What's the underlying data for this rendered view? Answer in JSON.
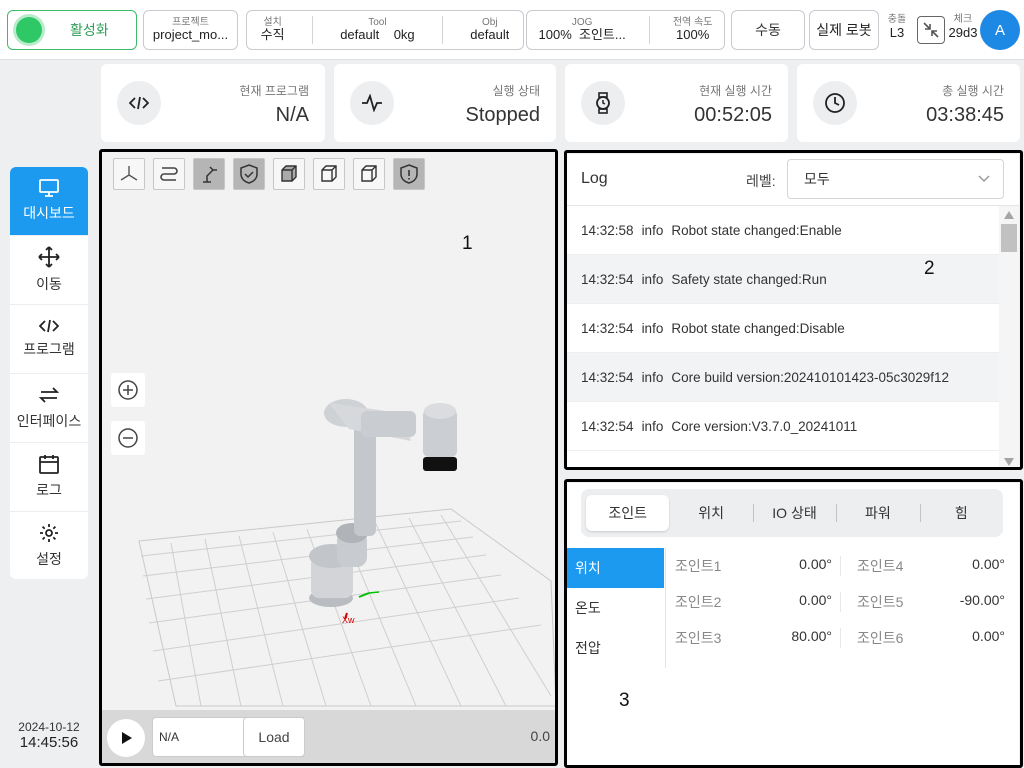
{
  "topbar": {
    "activate_label": "활성화",
    "project": {
      "label": "프로젝트",
      "value": "project_mo..."
    },
    "install": {
      "label": "설치",
      "value": "수직"
    },
    "tool": {
      "label": "Tool",
      "value": "default",
      "load": "0kg"
    },
    "obj": {
      "label": "Obj",
      "value": "default"
    },
    "jog": {
      "label": "JOG",
      "percent": "100%",
      "mode": "조인트..."
    },
    "global_speed": {
      "label": "전역 속도",
      "value": "100%"
    },
    "manual_label": "수동",
    "real_robot_label": "실제 로봇",
    "collision": {
      "label": "충돌",
      "value": "L3"
    },
    "check": {
      "label": "체크",
      "value": "29d3"
    },
    "avatar_letter": "A"
  },
  "cards": [
    {
      "label": "현재 프로그램",
      "value": "N/A",
      "icon": "code-icon"
    },
    {
      "label": "실행 상태",
      "value": "Stopped",
      "icon": "pulse-icon"
    },
    {
      "label": "현재 실행 시간",
      "value": "00:52:05",
      "icon": "watch-icon"
    },
    {
      "label": "총 실행 시간",
      "value": "03:38:45",
      "icon": "clock-icon"
    }
  ],
  "sidebar": {
    "items": [
      {
        "label": "대시보드",
        "icon": "monitor-icon",
        "active": true
      },
      {
        "label": "이동",
        "icon": "move-icon"
      },
      {
        "label": "프로그램",
        "icon": "code-icon"
      },
      {
        "label": "인터페이스",
        "icon": "swap-icon"
      },
      {
        "label": "로그",
        "icon": "calendar-icon"
      },
      {
        "label": "설정",
        "icon": "gear-icon"
      }
    ],
    "date": "2024-10-12",
    "time": "14:45:56"
  },
  "viewer": {
    "program_value": "N/A",
    "load_label": "Load",
    "speed_value": "0.0",
    "axis_label": "Xw"
  },
  "log": {
    "title": "Log",
    "level_label": "레벨:",
    "level_value": "모두",
    "rows": [
      {
        "time": "14:32:58",
        "level": "info",
        "message": "Robot state changed:Enable"
      },
      {
        "time": "14:32:54",
        "level": "info",
        "message": "Safety state changed:Run"
      },
      {
        "time": "14:32:54",
        "level": "info",
        "message": "Robot state changed:Disable"
      },
      {
        "time": "14:32:54",
        "level": "info",
        "message": "Core build version:202410101423-05c3029f12"
      },
      {
        "time": "14:32:54",
        "level": "info",
        "message": "Core version:V3.7.0_20241011"
      }
    ]
  },
  "joints": {
    "tabs": [
      "조인트",
      "위치",
      "IO 상태",
      "파워",
      "힘"
    ],
    "subnav": [
      "위치",
      "온도",
      "전압"
    ],
    "rows": [
      [
        {
          "name": "조인트1",
          "value": "0.00°"
        },
        {
          "name": "조인트4",
          "value": "0.00°"
        }
      ],
      [
        {
          "name": "조인트2",
          "value": "0.00°"
        },
        {
          "name": "조인트5",
          "value": "-90.00°"
        }
      ],
      [
        {
          "name": "조인트3",
          "value": "80.00°"
        },
        {
          "name": "조인트6",
          "value": "0.00°"
        }
      ]
    ]
  },
  "annotations": [
    "1",
    "2",
    "3"
  ],
  "colors": {
    "accent": "#1b9af0",
    "active_green": "#2ec866",
    "outline": "#000000"
  }
}
